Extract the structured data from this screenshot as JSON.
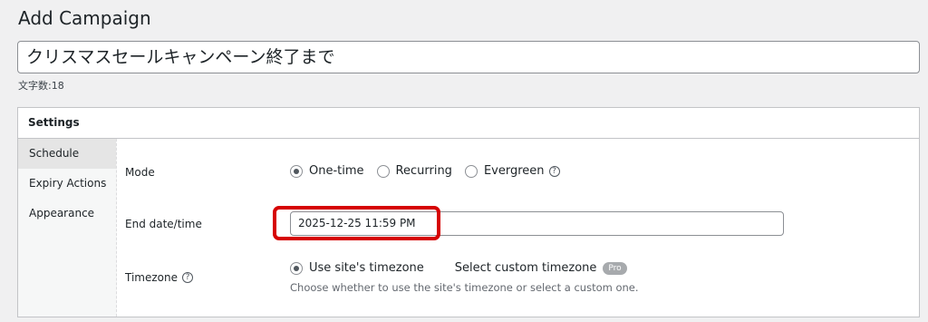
{
  "page": {
    "title": "Add Campaign"
  },
  "campaign": {
    "title_value": "クリスマスセールキャンペーン終了まで",
    "char_count": "文字数:18"
  },
  "settings": {
    "header": "Settings",
    "tabs": [
      {
        "label": "Schedule",
        "active": true
      },
      {
        "label": "Expiry Actions",
        "active": false
      },
      {
        "label": "Appearance",
        "active": false
      }
    ],
    "mode": {
      "label": "Mode",
      "options": [
        {
          "label": "One-time",
          "checked": true
        },
        {
          "label": "Recurring",
          "checked": false
        },
        {
          "label": "Evergreen",
          "checked": false
        }
      ],
      "help_icon": "?"
    },
    "end_date": {
      "label": "End date/time",
      "value": "2025-12-25 11:59 PM",
      "highlight_color": "#d60000"
    },
    "timezone": {
      "label": "Timezone",
      "help_icon": "?",
      "options": [
        {
          "label": "Use site's timezone",
          "checked": true
        },
        {
          "label": "Select custom timezone",
          "checked": false
        }
      ],
      "pro_badge": "Pro",
      "description": "Choose whether to use the site's timezone or select a custom one."
    }
  }
}
